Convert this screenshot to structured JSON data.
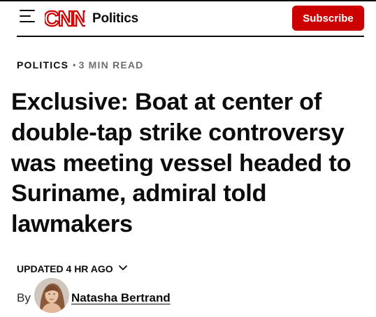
{
  "header": {
    "brand": "CNN",
    "section": "Politics",
    "subscribe_label": "Subscribe",
    "menu_icon": "hamburger-menu-icon",
    "brand_color": "#cc0000"
  },
  "article": {
    "category": "POLITICS",
    "separator": "•",
    "read_time": "3 MIN READ",
    "headline": "Exclusive: Boat at center of double-tap strike controversy was meeting vessel headed to Suriname, admiral told lawmakers",
    "updated": "UPDATED 4 HR AGO",
    "updated_icon": "chevron-down-icon",
    "byline_prefix": "By",
    "author": "Natasha Bertrand"
  }
}
